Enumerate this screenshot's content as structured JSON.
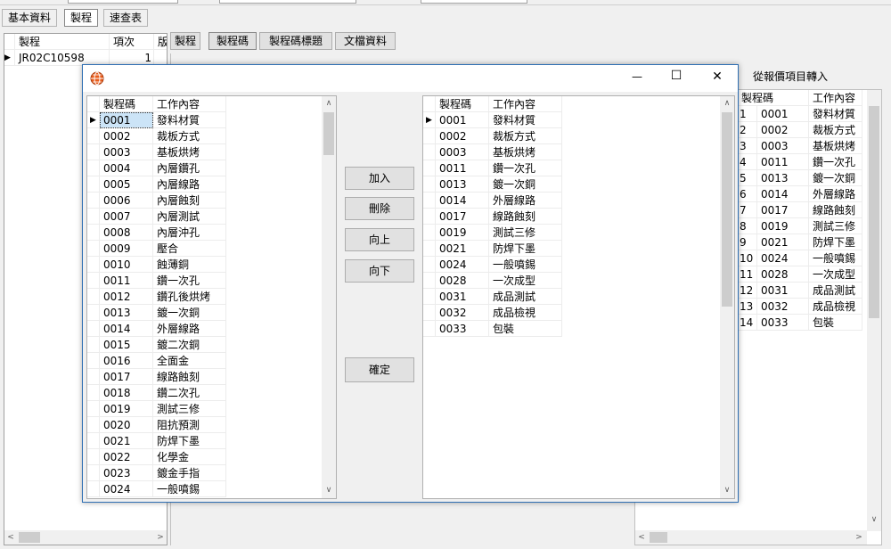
{
  "top_tabs": [
    "基本資料",
    "製程",
    "速查表"
  ],
  "left_grid": {
    "headers": [
      "製程",
      "項次",
      "版"
    ],
    "rows": [
      [
        "JR02C10598",
        "1"
      ]
    ]
  },
  "sub_tabs": [
    "製程",
    "製程碼",
    "製程碼標題",
    "文檔資料"
  ],
  "quote_title": "從報價項目轉入",
  "quote_grid": {
    "headers": [
      "製程碼",
      "工作內容"
    ],
    "rows": [
      [
        "1",
        "0001",
        "發料材質"
      ],
      [
        "2",
        "0002",
        "裁板方式"
      ],
      [
        "3",
        "0003",
        "基板烘烤"
      ],
      [
        "4",
        "0011",
        "鑽一次孔"
      ],
      [
        "5",
        "0013",
        "鍍一次銅"
      ],
      [
        "6",
        "0014",
        "外層線路"
      ],
      [
        "7",
        "0017",
        "線路蝕刻"
      ],
      [
        "8",
        "0019",
        "測試三修"
      ],
      [
        "9",
        "0021",
        "防焊下墨"
      ],
      [
        "10",
        "0024",
        "一般噴錫"
      ],
      [
        "11",
        "0028",
        "一次成型"
      ],
      [
        "12",
        "0031",
        "成品測試"
      ],
      [
        "13",
        "0032",
        "成品檢視"
      ],
      [
        "14",
        "0033",
        "包裝"
      ]
    ]
  },
  "dialog": {
    "window_buttons": {
      "minimize": "—",
      "maximize": "☐",
      "close": "✕"
    },
    "source": {
      "headers": [
        "製程碼",
        "工作內容"
      ],
      "rows": [
        [
          "0001",
          "發料材質"
        ],
        [
          "0002",
          "裁板方式"
        ],
        [
          "0003",
          "基板烘烤"
        ],
        [
          "0004",
          "內層鑽孔"
        ],
        [
          "0005",
          "內層線路"
        ],
        [
          "0006",
          "內層蝕刻"
        ],
        [
          "0007",
          "內層測試"
        ],
        [
          "0008",
          "內層沖孔"
        ],
        [
          "0009",
          "壓合"
        ],
        [
          "0010",
          "蝕薄銅"
        ],
        [
          "0011",
          "鑽一次孔"
        ],
        [
          "0012",
          "鑽孔後烘烤"
        ],
        [
          "0013",
          "鍍一次銅"
        ],
        [
          "0014",
          "外層線路"
        ],
        [
          "0015",
          "鍍二次銅"
        ],
        [
          "0016",
          "全面金"
        ],
        [
          "0017",
          "線路蝕刻"
        ],
        [
          "0018",
          "鑽二次孔"
        ],
        [
          "0019",
          "測試三修"
        ],
        [
          "0020",
          "阻抗預測"
        ],
        [
          "0021",
          "防焊下墨"
        ],
        [
          "0022",
          "化學金"
        ],
        [
          "0023",
          "鍍金手指"
        ],
        [
          "0024",
          "一般噴錫"
        ]
      ]
    },
    "buttons": {
      "add": "加入",
      "remove": "刪除",
      "up": "向上",
      "down": "向下",
      "ok": "確定"
    },
    "target": {
      "headers": [
        "製程碼",
        "工作內容"
      ],
      "rows": [
        [
          "0001",
          "發料材質"
        ],
        [
          "0002",
          "裁板方式"
        ],
        [
          "0003",
          "基板烘烤"
        ],
        [
          "0011",
          "鑽一次孔"
        ],
        [
          "0013",
          "鍍一次銅"
        ],
        [
          "0014",
          "外層線路"
        ],
        [
          "0017",
          "線路蝕刻"
        ],
        [
          "0019",
          "測試三修"
        ],
        [
          "0021",
          "防焊下墨"
        ],
        [
          "0024",
          "一般噴錫"
        ],
        [
          "0028",
          "一次成型"
        ],
        [
          "0031",
          "成品測試"
        ],
        [
          "0032",
          "成品檢視"
        ],
        [
          "0033",
          "包裝"
        ]
      ]
    }
  }
}
